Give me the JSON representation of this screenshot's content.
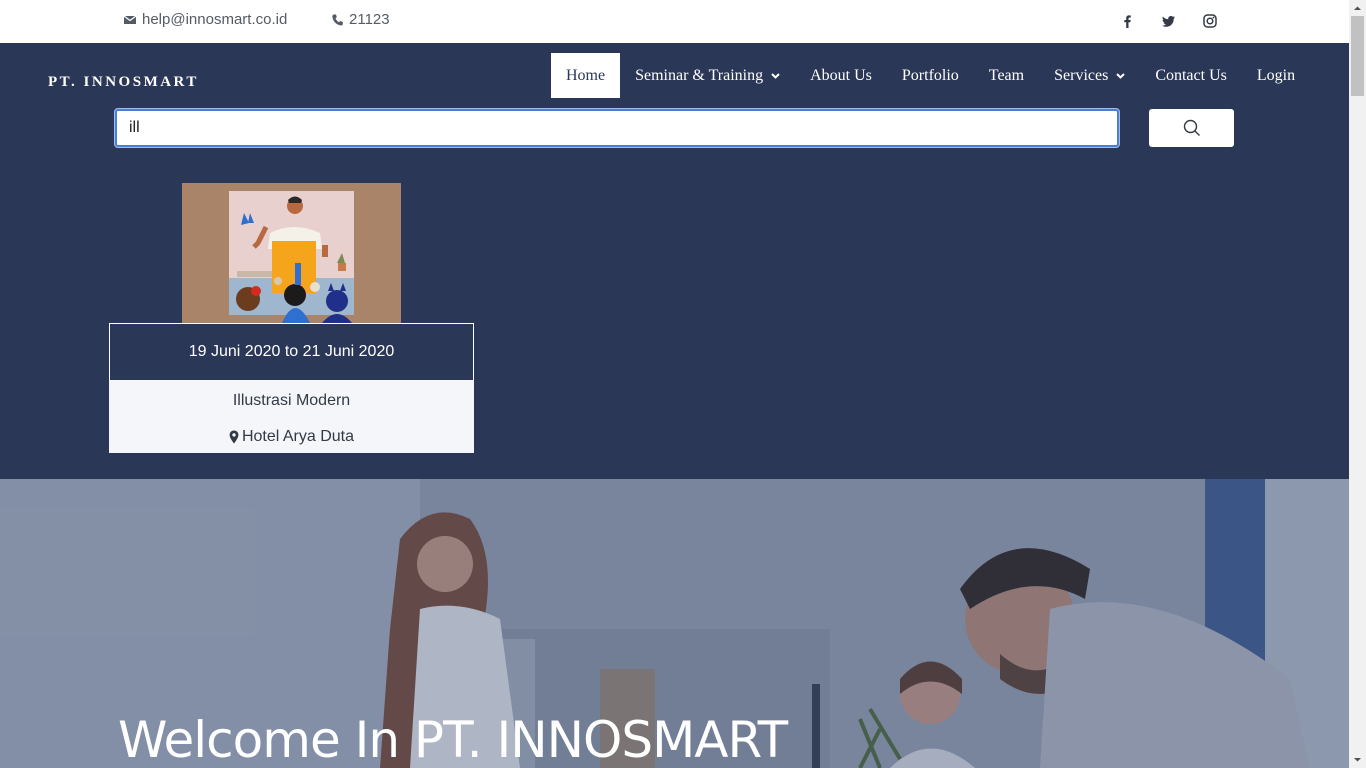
{
  "topbar": {
    "email": "help@innosmart.co.id",
    "phone": "21123",
    "social": [
      "facebook-icon",
      "twitter-icon",
      "instagram-icon"
    ]
  },
  "header": {
    "brand": "PT. INNOSMART",
    "nav": [
      {
        "label": "Home",
        "active": true
      },
      {
        "label": "Seminar & Training",
        "dropdown": true
      },
      {
        "label": "About Us"
      },
      {
        "label": "Portfolio"
      },
      {
        "label": "Team"
      },
      {
        "label": "Services",
        "dropdown": true
      },
      {
        "label": "Contact Us"
      },
      {
        "label": "Login"
      }
    ]
  },
  "search": {
    "value": "ill"
  },
  "result_card": {
    "date": "19 Juni 2020 to 21 Juni 2020",
    "title": "Illustrasi Modern",
    "location": "Hotel Arya Duta"
  },
  "hero": {
    "title": "Welcome In PT. INNOSMART"
  },
  "colors": {
    "navy": "#2b3757",
    "focus": "#4a7fd4"
  }
}
